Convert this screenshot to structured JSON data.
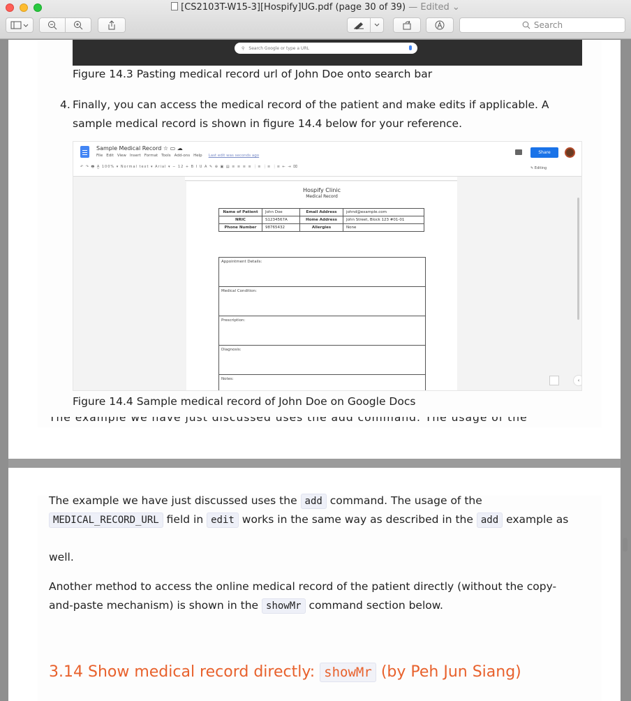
{
  "window": {
    "title": "[CS2103T-W15-3][Hospify]UG.pdf (page 30 of 39)",
    "edited": "— Edited",
    "search_placeholder": "Search"
  },
  "page1": {
    "browser_search_placeholder": "Search Google or type a URL",
    "fig143_caption": "Figure 14.3 Pasting medical record url of John Doe onto search bar",
    "step4_number": "4.",
    "step4_line1": "Finally, you can access the medical record of the patient and make edits if applicable. A",
    "step4_line2": "sample medical record is shown in figure 14.4 below for your reference.",
    "gdocs": {
      "doc_title": "Sample Medical Record",
      "menu": [
        "File",
        "Edit",
        "View",
        "Insert",
        "Format",
        "Tools",
        "Add-ons",
        "Help"
      ],
      "last_edit": "Last edit was seconds ago",
      "share": "Share",
      "toolbar": "↶ ↷ 🖶 A̲ 100% ▾ Normal text ▾ Arial ▾ − 12 + B I U A ✎ ⊕ ▣ ▤ ≡ ≡ ≡ ≡ ⋮≡ ⋮≡ ⋮≡ ⇤ ⇥ ⌧",
      "editing": "✎ Editing",
      "clinic": "Hospify Clinic",
      "record": "Medical Record",
      "table": [
        [
          "Name of Patient",
          "John Doe",
          "Email Address",
          "johnd@example.com"
        ],
        [
          "NRIC",
          "S1234567A",
          "Home Address",
          "John Street, Block 123 #01-01"
        ],
        [
          "Phone Number",
          "98765432",
          "Allergies",
          "None"
        ]
      ],
      "boxes": [
        "Appointment Details:",
        "Medical Condition:",
        "Prescription:",
        "Diagnosis:",
        "Notes:"
      ]
    },
    "fig144_caption": "Figure 14.4 Sample medical record of John Doe on Google Docs",
    "cut_line": "The example we have just discussed uses the  add  command. The usage of the"
  },
  "page2": {
    "line1_a": "The example we have just discussed uses the",
    "line1_code": "add",
    "line1_b": "command. The usage of the",
    "line2_code1": "MEDICAL_RECORD_URL",
    "line2_a": "field in",
    "line2_code2": "edit",
    "line2_b": "works in the same way as described in the",
    "line2_code3": "add",
    "line2_c": "example as",
    "line3": "well.",
    "para2_line1": "Another method to access the online medical record of the patient directly (without the copy-",
    "para2_line2_a": "and-paste mechanism) is shown in the",
    "para2_code": "showMr",
    "para2_line2_b": "command section below.",
    "heading_a": "3.14 Show medical record directly:",
    "heading_code": "showMr",
    "heading_b": "(by Peh Jun Siang)"
  }
}
